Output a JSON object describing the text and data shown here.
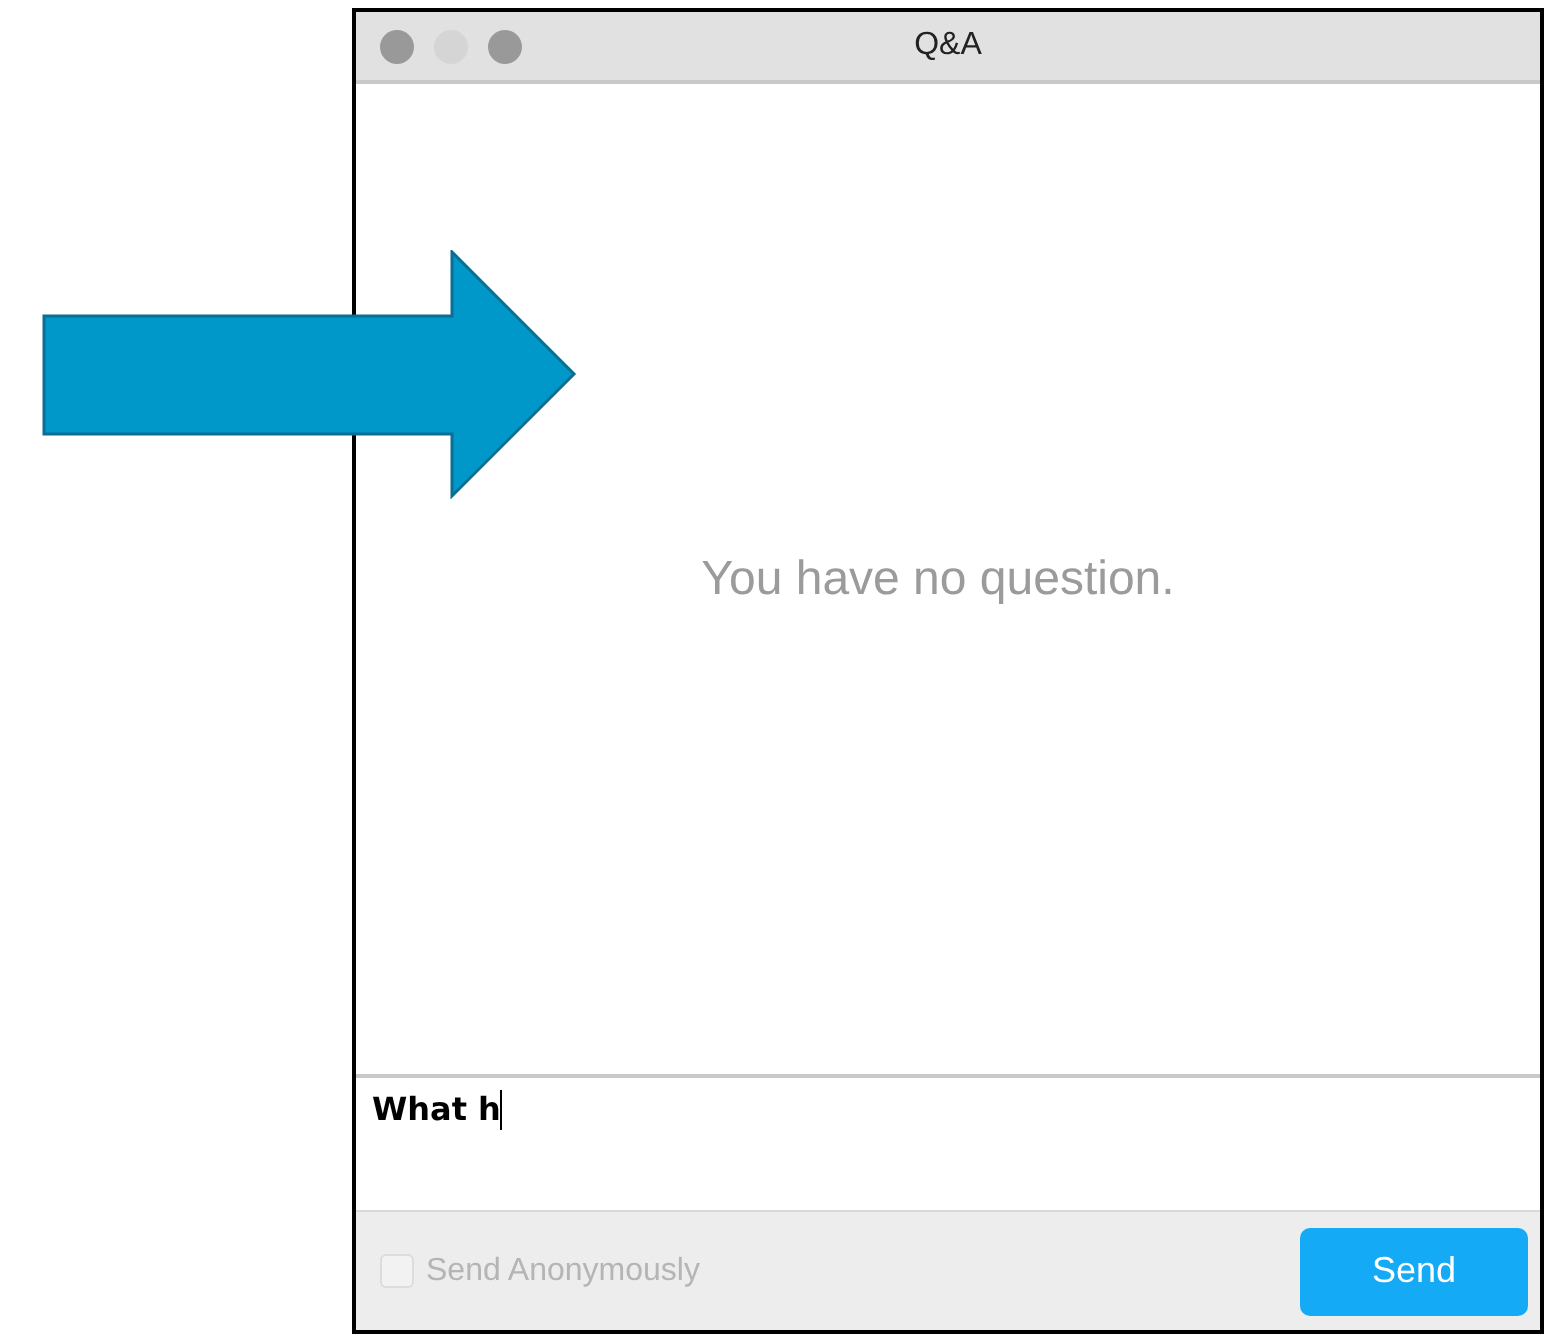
{
  "window": {
    "title": "Q&A"
  },
  "empty_message": "You have no question.",
  "question_field": {
    "value": "What h"
  },
  "anonymous_checkbox": {
    "label": "Send Anonymously",
    "checked": false,
    "disabled": true
  },
  "send_button": {
    "label": "Send"
  }
}
